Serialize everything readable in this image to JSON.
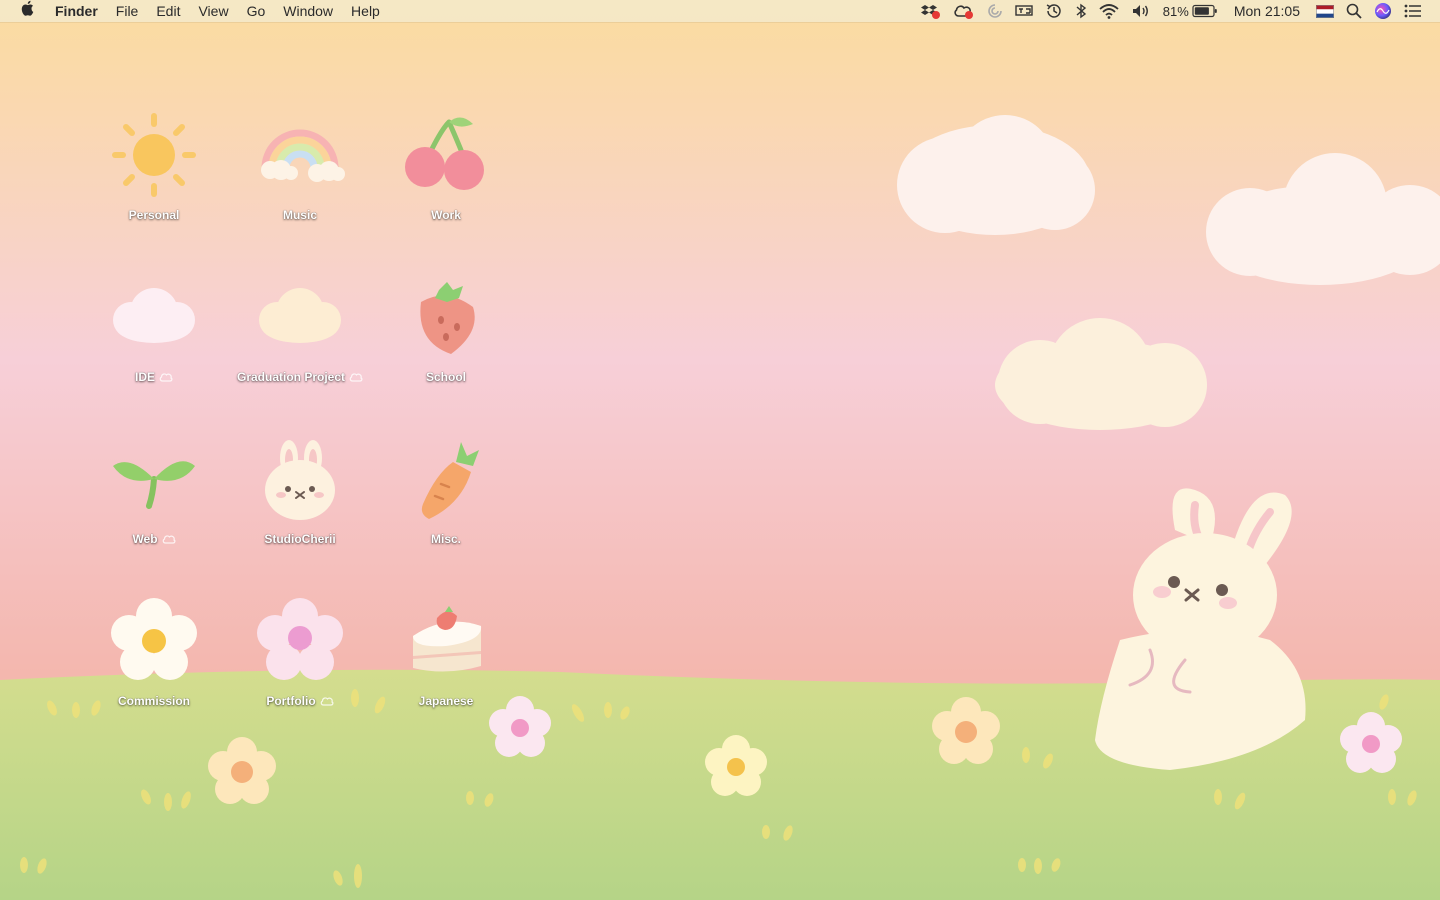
{
  "menubar": {
    "apple_icon": "apple-logo-icon",
    "app_name": "Finder",
    "menus": [
      "File",
      "Edit",
      "View",
      "Go",
      "Window",
      "Help"
    ],
    "status": {
      "battery_percent": "81%",
      "battery_level": 0.81,
      "clock": "Mon 21:05"
    }
  },
  "desktop": {
    "icons": [
      {
        "label": "Personal",
        "art": "sun-icon",
        "cloud": false
      },
      {
        "label": "Music",
        "art": "rainbow-icon",
        "cloud": false
      },
      {
        "label": "Work",
        "art": "cherry-icon",
        "cloud": false
      },
      {
        "label": "IDE",
        "art": "cloud-pink-icon",
        "cloud": true
      },
      {
        "label": "Graduation Project",
        "art": "cloud-cream-icon",
        "cloud": true
      },
      {
        "label": "School",
        "art": "strawberry-icon",
        "cloud": false
      },
      {
        "label": "Web",
        "art": "sprout-icon",
        "cloud": true
      },
      {
        "label": "StudioCherii",
        "art": "bunny-face-icon",
        "cloud": false
      },
      {
        "label": "Misc.",
        "art": "carrot-icon",
        "cloud": false
      },
      {
        "label": "Commission",
        "art": "white-flower-icon",
        "cloud": false
      },
      {
        "label": "Portfolio",
        "art": "pink-flower-icon",
        "cloud": true
      },
      {
        "label": "Japanese",
        "art": "cake-icon",
        "cloud": false
      }
    ]
  },
  "colors": {
    "sky_top": "#fbe3a8",
    "sky_mid": "#f7cfd8",
    "sky_bottom": "#f4b9b0",
    "grass": "#c8dc8c",
    "cloud": "#fdf3ec",
    "bunny": "#fdf4de"
  }
}
